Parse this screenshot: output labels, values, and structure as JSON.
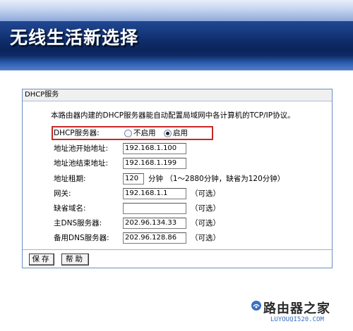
{
  "banner": {
    "title": "无线生活新选择"
  },
  "panel": {
    "title": "DHCP服务",
    "description": "本路由器内建的DHCP服务器能自动配置局域网中各计算机的TCP/IP协议。"
  },
  "dhcp_server": {
    "label": "DHCP服务器:",
    "options": [
      "不启用",
      "启用"
    ],
    "selected": "启用"
  },
  "fields": {
    "start_label": "地址池开始地址:",
    "start_value": "192.168.1.100",
    "end_label": "地址池结束地址:",
    "end_value": "192.168.1.199",
    "lease_label": "地址租期:",
    "lease_value": "120",
    "lease_suffix": "分钟 （1～2880分钟，缺省为120分钟）",
    "gateway_label": "网关:",
    "gateway_value": "192.168.1.1",
    "gateway_suffix": "（可选）",
    "domain_label": "缺省域名:",
    "domain_value": "",
    "domain_suffix": "（可选）",
    "dns1_label": "主DNS服务器:",
    "dns1_value": "202.96.134.33",
    "dns1_suffix": "（可选）",
    "dns2_label": "备用DNS服务器:",
    "dns2_value": "202.96.128.86",
    "dns2_suffix": "（可选）"
  },
  "buttons": {
    "save": "保存",
    "help": "帮助"
  },
  "watermark": {
    "text": "路由器之家",
    "url": "LUYOUQI520.COM"
  },
  "colors": {
    "highlight_box": "#c62828",
    "panel_border": "#6b8fc6",
    "banner_dark": "#0f2d6b"
  }
}
